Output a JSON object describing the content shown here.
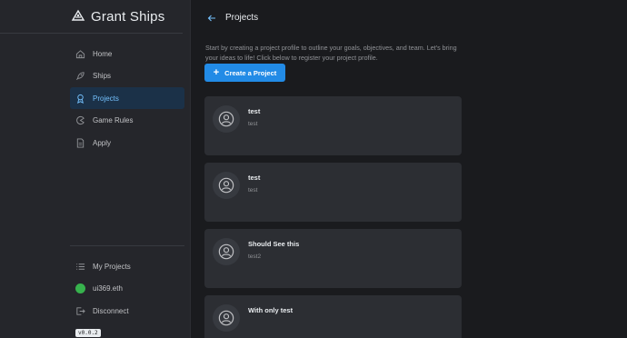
{
  "brand": {
    "title": "Grant Ships",
    "logo_icon": "ship-logo-icon"
  },
  "sidebar": {
    "items": [
      {
        "label": "Home",
        "icon": "home-icon",
        "active": false
      },
      {
        "label": "Ships",
        "icon": "rocket-icon",
        "active": false
      },
      {
        "label": "Projects",
        "icon": "award-icon",
        "active": true
      },
      {
        "label": "Game Rules",
        "icon": "pacman-icon",
        "active": false
      },
      {
        "label": "Apply",
        "icon": "file-icon",
        "active": false
      }
    ],
    "bottom": {
      "my_projects": "My Projects",
      "account": "ui369.eth",
      "disconnect": "Disconnect"
    },
    "version": "v0.0.2"
  },
  "main": {
    "title": "Projects",
    "intro": "Start by creating a project profile to outline your goals, objectives, and team. Let's bring your ideas to life! Click below to register your project profile.",
    "create_label": "Create a Project",
    "projects": [
      {
        "name": "test",
        "description": "test"
      },
      {
        "name": "test",
        "description": "test"
      },
      {
        "name": "Should See this",
        "description": "test2"
      },
      {
        "name": "With only test",
        "description": ""
      }
    ]
  },
  "colors": {
    "accent": "#228be6",
    "active_bg": "#1b3148",
    "active_text": "#74c0fc",
    "card_bg": "#2c2e33",
    "sidebar_bg": "#25262b",
    "page_bg": "#1a1b1e"
  }
}
